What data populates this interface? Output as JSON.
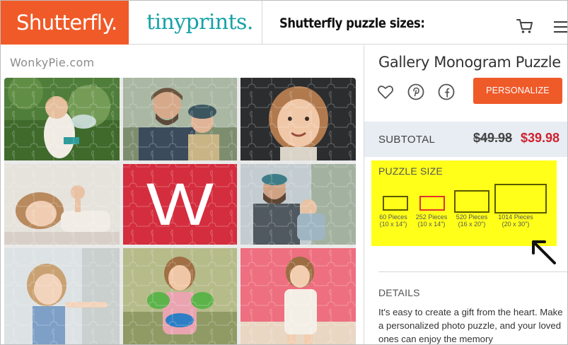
{
  "header": {
    "brand_shutterfly": "Shutterfly.",
    "brand_tinyprints": "tinyprints.",
    "title": "Shutterfly puzzle sizes:",
    "cart_icon": "cart-icon",
    "menu_icon": "hamburger-menu-icon"
  },
  "watermark": "WonkyPie.com",
  "puzzle": {
    "monogram_letter": "W",
    "monogram_color": "#d42d3d"
  },
  "product": {
    "title": "Gallery Monogram Puzzle",
    "share_icons": [
      "heart-icon",
      "pinterest-icon",
      "facebook-icon"
    ],
    "personalize_label": "PERSONALIZE",
    "accent_color": "#ef5a29"
  },
  "pricing": {
    "subtotal_label": "SUBTOTAL",
    "old_price": "$49.98",
    "new_price": "$39.98",
    "sale_color": "#d0202e"
  },
  "puzzle_size": {
    "heading": "PUZZLE SIZE",
    "options": [
      {
        "pieces": "60 Pieces",
        "dims": "(10 x 14\")",
        "selected": false
      },
      {
        "pieces": "252 Pieces",
        "dims": "(10 x 14\")",
        "selected": true
      },
      {
        "pieces": "520 Pieces",
        "dims": "(16 x 20\")",
        "selected": false
      },
      {
        "pieces": "1014 Pieces",
        "dims": "(20 x 30\")",
        "selected": false
      }
    ],
    "highlight_color": "#ffff1a"
  },
  "details": {
    "heading": "DETAILS",
    "text": "It's easy to create a gift from the heart. Make a personalized photo puzzle, and your loved ones can enjoy the memory"
  }
}
